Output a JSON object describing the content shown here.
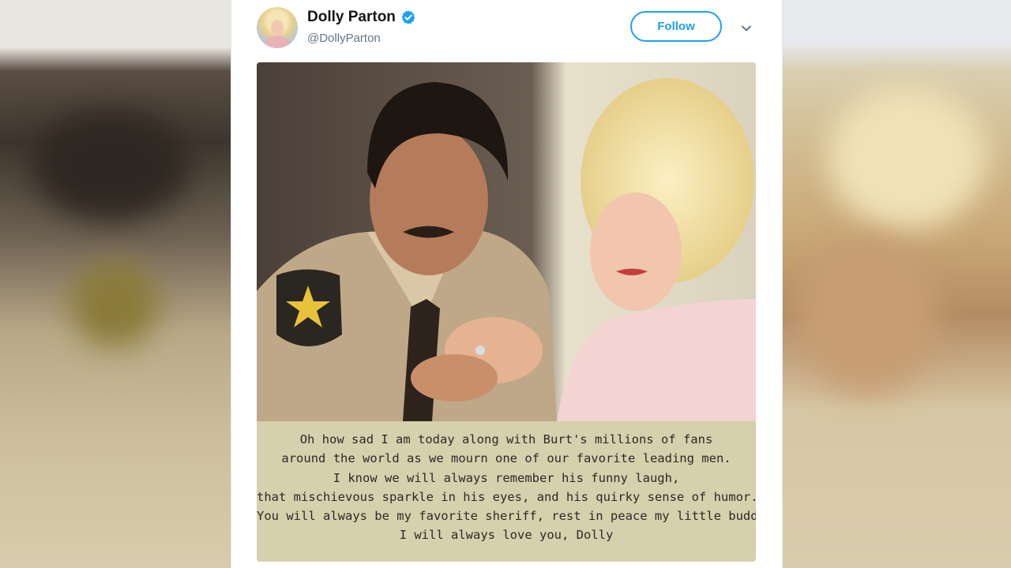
{
  "tweet": {
    "display_name": "Dolly Parton",
    "handle": "@DollyParton",
    "follow_label": "Follow",
    "verified": true,
    "avatar_icon": "profile-photo",
    "menu_icon": "chevron-down-icon"
  },
  "media": {
    "type": "photo-with-caption",
    "caption_lines": [
      "Oh how sad I am today along with Burt's millions of fans",
      "around the world as we mourn one of our favorite leading men.",
      "I know we will always remember his funny laugh,",
      "that mischievous sparkle in his eyes, and his quirky sense of humor.",
      "You will always be my favorite sheriff, rest in peace my little buddy.",
      "I will always love you, Dolly"
    ]
  },
  "colors": {
    "accent": "#1da1f2",
    "caption_panel": "#d7d0ad",
    "name_text": "#14171a",
    "handle_text": "#657786"
  }
}
